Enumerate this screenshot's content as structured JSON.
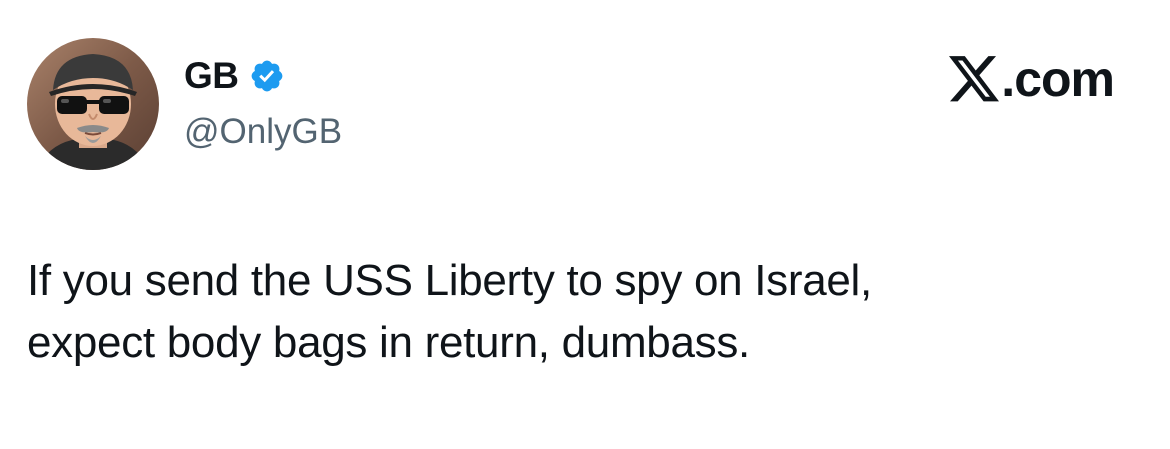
{
  "author": {
    "display_name": "GB",
    "handle": "@OnlyGB",
    "verified_icon": "verified-badge-icon",
    "verified_color": "#1d9bf0"
  },
  "brand": {
    "logo_icon": "x-logo-icon",
    "domain": ".com"
  },
  "post": {
    "lines": [
      "If you send the USS Liberty to spy on Israel,",
      "expect body bags in return, dumbass."
    ]
  },
  "colors": {
    "text": "#0f1419",
    "secondary_text": "#536471",
    "background": "#ffffff"
  }
}
